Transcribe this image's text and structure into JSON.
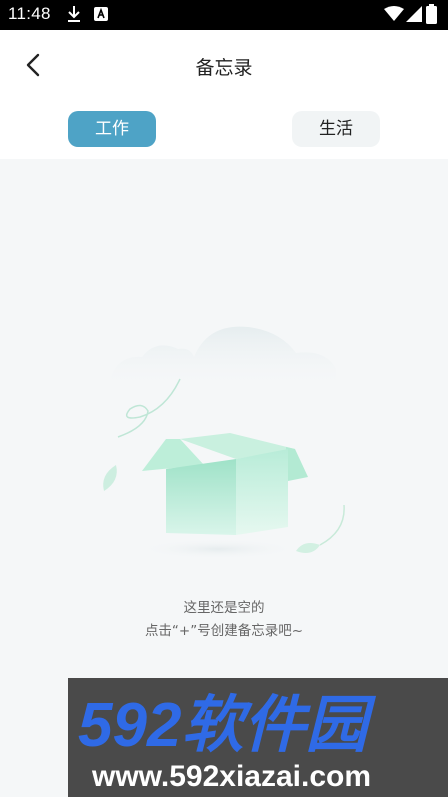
{
  "status_bar": {
    "time": "11:48"
  },
  "header": {
    "title": "备忘录"
  },
  "tabs": [
    {
      "label": "工作",
      "active": true
    },
    {
      "label": "生活",
      "active": false
    }
  ],
  "empty_state": {
    "line1": "这里还是空的",
    "line2": "点击“+”号创建备忘录吧~"
  },
  "watermark": {
    "brand": "592软件园",
    "url": "www.592xiazai.com"
  },
  "colors": {
    "accent": "#4ea3c6",
    "background": "#f5f7f8",
    "box": "#a8e6cf"
  }
}
